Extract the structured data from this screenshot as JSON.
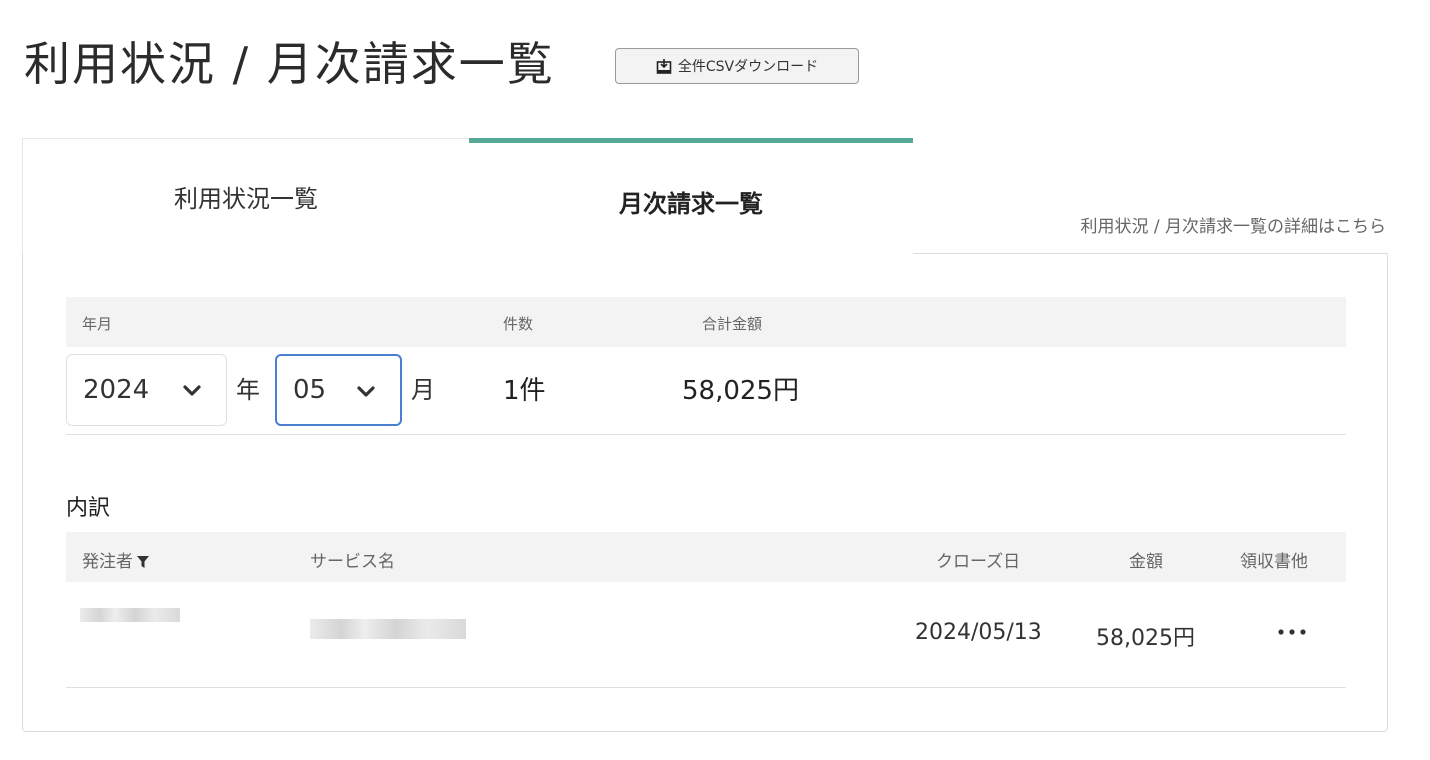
{
  "page": {
    "title": "利用状況 / 月次請求一覧",
    "csv_button_label": "全件CSVダウンロード"
  },
  "tabs": [
    {
      "label": "利用状況一覧",
      "active": false
    },
    {
      "label": "月次請求一覧",
      "active": true
    }
  ],
  "detail_link": "利用状況 / 月次請求一覧の詳細はこちら",
  "summary": {
    "headers": {
      "year_month": "年月",
      "count": "件数",
      "total": "合計金額"
    },
    "year_select_value": "2024",
    "year_unit": "年",
    "month_select_value": "05",
    "month_unit": "月",
    "count_value": "1件",
    "total_value": "58,025円"
  },
  "breakdown": {
    "label": "内訳",
    "columns": {
      "orderer": "発注者",
      "service": "サービス名",
      "close_date": "クローズ日",
      "amount": "金額",
      "receipt": "領収書他"
    },
    "rows": [
      {
        "orderer": "",
        "service": "",
        "close_date": "2024/05/13",
        "amount": "58,025円"
      }
    ]
  },
  "colors": {
    "accent": "#56a994",
    "focus": "#4a7fd0",
    "header_bg": "#f3f3f3"
  },
  "icons": {
    "csv": "download-icon",
    "select": "chevron-down-icon",
    "filter": "filter-icon",
    "more": "more-icon"
  }
}
